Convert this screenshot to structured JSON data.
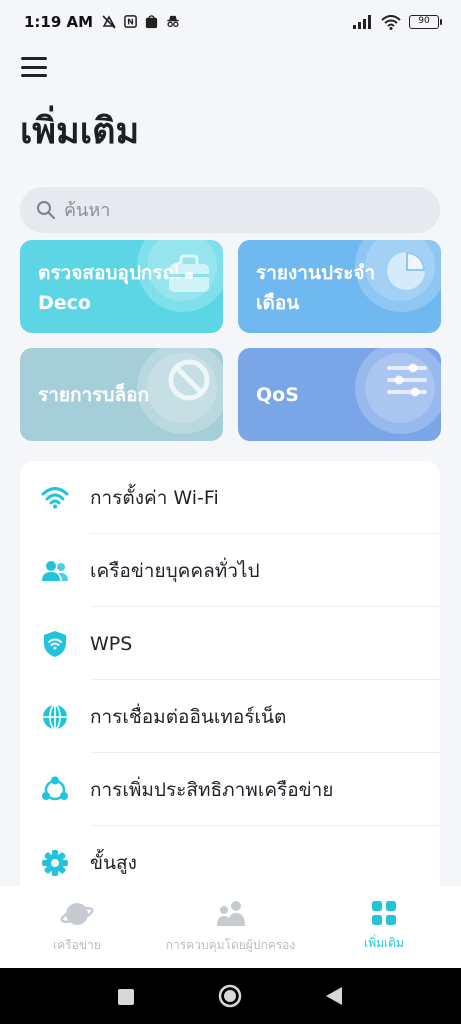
{
  "status_bar": {
    "time": "1:19 AM",
    "battery": "90"
  },
  "header": {
    "title": "เพิ่มเติม"
  },
  "search": {
    "placeholder": "ค้นหา"
  },
  "tiles": [
    {
      "label": "ตรวจสอบอุปกรณ์ Deco",
      "icon": "toolbox-icon",
      "color": "#5cd6e4"
    },
    {
      "label": "รายงานประจำเดือน",
      "icon": "pie-chart-icon",
      "color": "#6fb8f0"
    },
    {
      "label": "รายการบล็อก",
      "icon": "block-icon",
      "color": "#a6ced8"
    },
    {
      "label": "QoS",
      "icon": "sliders-icon",
      "color": "#7aa6e8"
    }
  ],
  "menu_items": [
    {
      "label": "การตั้งค่า Wi-Fi",
      "icon": "wifi-icon"
    },
    {
      "label": "เครือข่ายบุคคลทั่วไป",
      "icon": "guests-icon"
    },
    {
      "label": "WPS",
      "icon": "wps-shield-icon"
    },
    {
      "label": "การเชื่อมต่ออินเทอร์เน็ต",
      "icon": "globe-icon"
    },
    {
      "label": "การเพิ่มประสิทธิภาพเครือข่าย",
      "icon": "network-optimize-icon"
    },
    {
      "label": "ขั้นสูง",
      "icon": "gear-icon"
    }
  ],
  "bottom_nav": [
    {
      "label": "เครือข่าย",
      "icon": "planet-icon",
      "active": false
    },
    {
      "label": "การควบคุมโดยผู้ปกครอง",
      "icon": "family-icon",
      "active": false
    },
    {
      "label": "เพิ่มเติม",
      "icon": "grid-icon",
      "active": true
    }
  ],
  "colors": {
    "accent": "#22c4dc",
    "background": "#f4f6f9"
  }
}
